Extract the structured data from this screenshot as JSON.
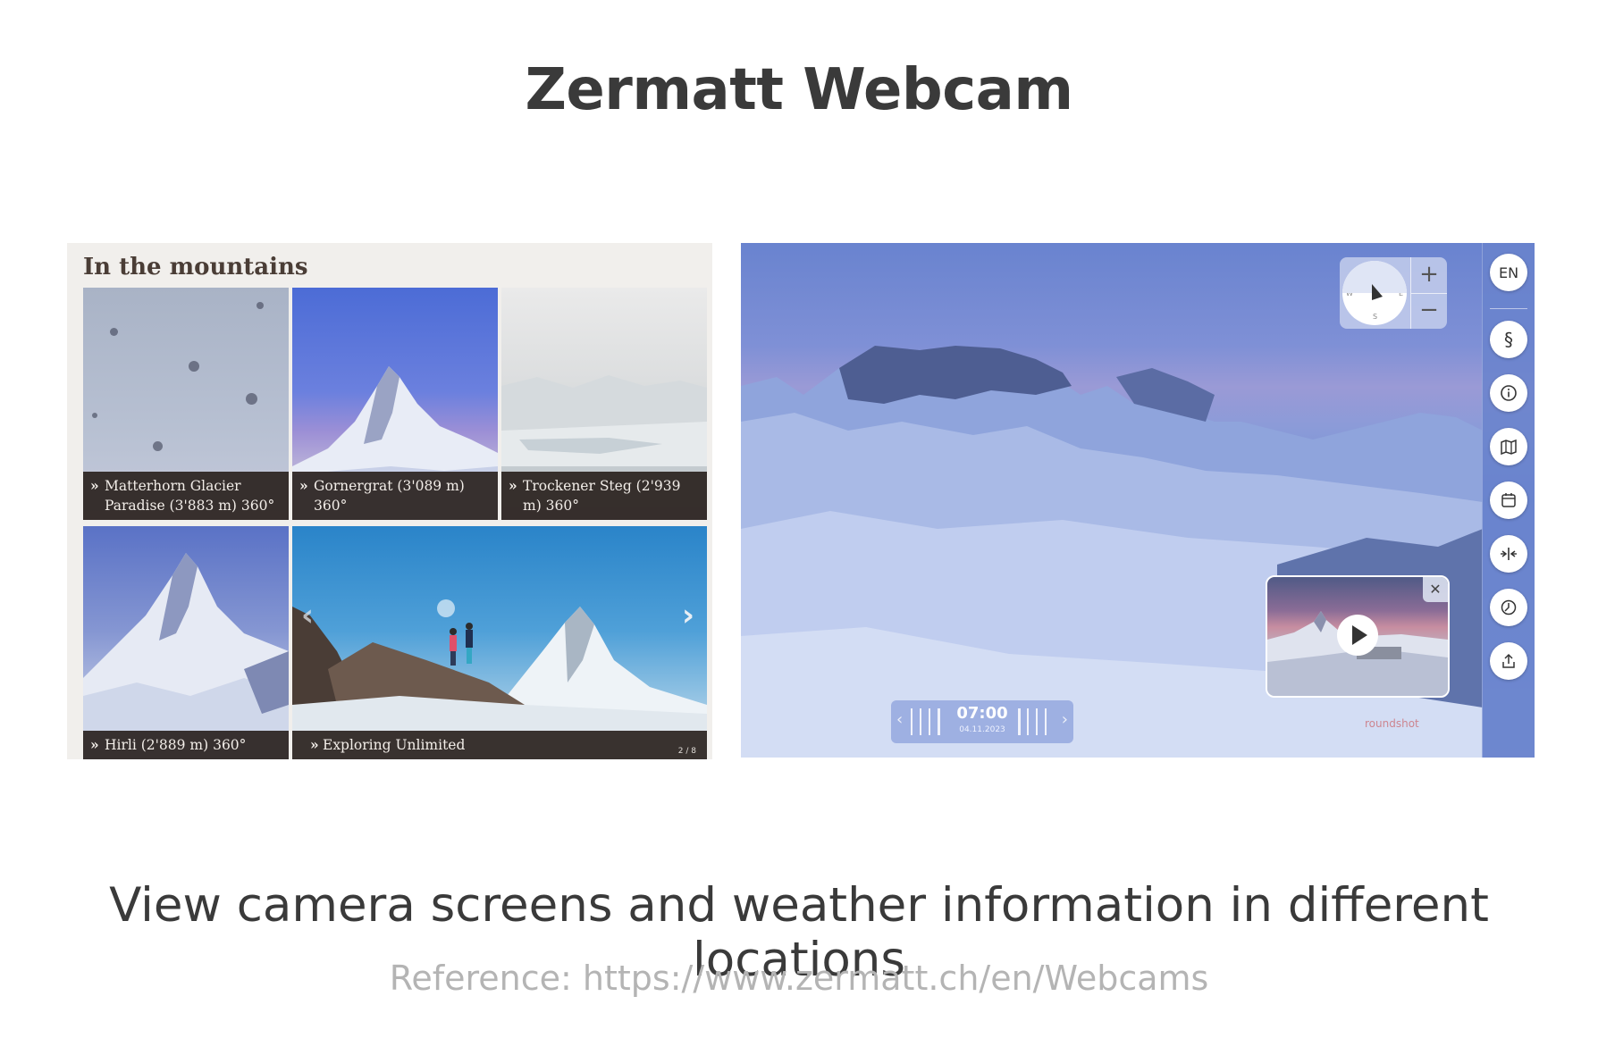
{
  "page": {
    "title": "Zermatt Webcam",
    "caption": "View camera screens and weather information in different locations",
    "reference": "Reference: https://www.zermatt.ch/en/Webcams"
  },
  "gallery": {
    "heading": "In the mountains",
    "tiles": [
      {
        "label": "Matterhorn Glacier Paradise (3'883 m) 360°"
      },
      {
        "label": "Gornergrat (3'089 m) 360°"
      },
      {
        "label": "Trockener Steg (2'939 m) 360°"
      },
      {
        "label": "Hirli (2'889 m) 360°"
      },
      {
        "label": "Exploring Unlimited"
      }
    ],
    "arrow_glyph": "»",
    "page_indicator": "2 / 8"
  },
  "viewer": {
    "language": "EN",
    "compass": {
      "n": "N",
      "e": "E",
      "s": "S",
      "w": "W"
    },
    "zoom_in": "+",
    "zoom_out": "−",
    "time": "07:00",
    "date": "04.11.2023",
    "close_glyph": "✕",
    "brand": "roundshot",
    "sidebar_icons": [
      "paragraph-icon",
      "info-icon",
      "map-icon",
      "calendar-icon",
      "compare-icon",
      "history-icon",
      "share-icon"
    ]
  }
}
